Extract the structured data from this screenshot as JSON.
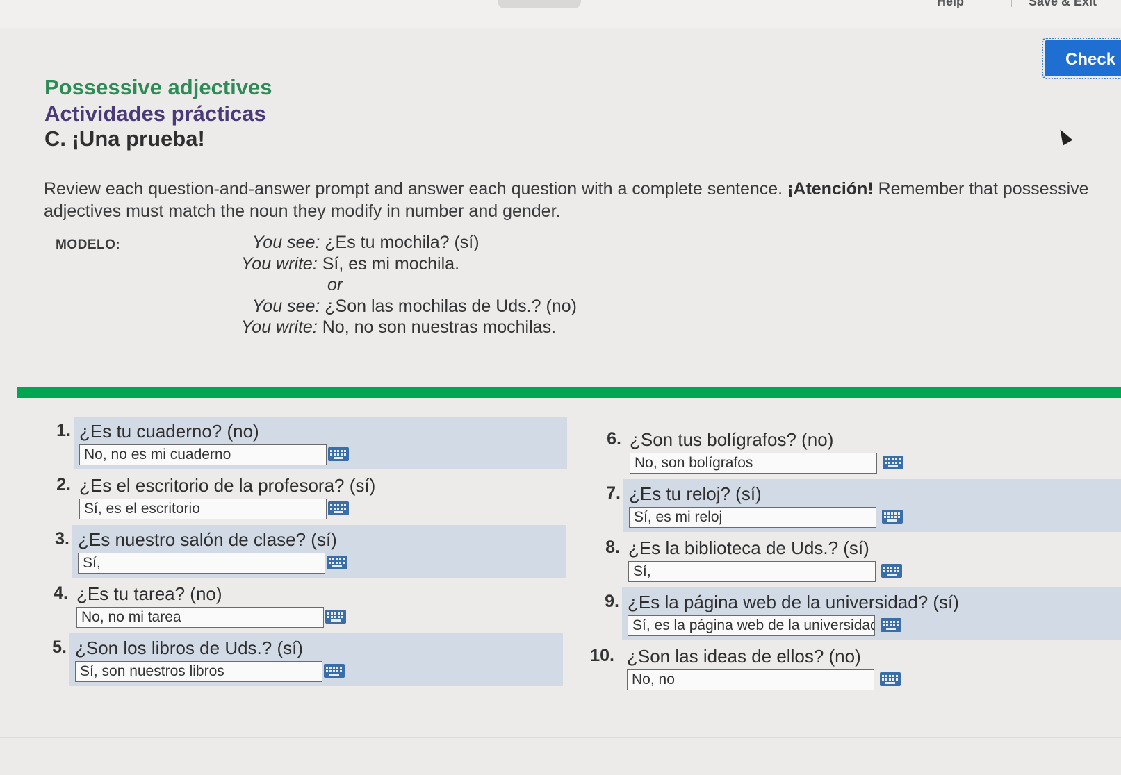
{
  "topbar": {
    "help": "Help",
    "save_exit": "Save & Exit"
  },
  "check_button": "Check",
  "header": {
    "topic": "Possessive adjectives",
    "subtitle": "Actividades prácticas",
    "section": "C. ¡Una prueba!"
  },
  "instructions": {
    "before": "Review each question-and-answer prompt and answer each question with a complete sentence. ",
    "bold": "¡Atención!",
    "after": " Remember that possessive adjectives must match the noun they modify in number and gender."
  },
  "modelo": {
    "label": "MODELO:",
    "see_label": "You see:",
    "write_label": "You write:",
    "see1": "¿Es tu mochila? (sí)",
    "write1": "Sí, es mi mochila.",
    "or": "or",
    "see2": "¿Son las mochilas de Uds.? (no)",
    "write2": "No, no son nuestras mochilas."
  },
  "questions": [
    {
      "num": "1.",
      "text": "¿Es tu cuaderno? (no)",
      "answer": "No, no es mi cuaderno"
    },
    {
      "num": "2.",
      "text": "¿Es el escritorio de la profesora? (sí)",
      "answer": "Sí, es el escritorio"
    },
    {
      "num": "3.",
      "text": "¿Es nuestro salón de clase? (sí)",
      "answer": "Sí,"
    },
    {
      "num": "4.",
      "text": "¿Es tu tarea? (no)",
      "answer": "No, no mi tarea"
    },
    {
      "num": "5.",
      "text": "¿Son los libros de Uds.? (sí)",
      "answer": "Sí, son nuestros libros"
    },
    {
      "num": "6.",
      "text": "¿Son tus bolígrafos? (no)",
      "answer": "No,  son bolígrafos"
    },
    {
      "num": "7.",
      "text": "¿Es tu reloj? (sí)",
      "answer": "Sí, es mi reloj"
    },
    {
      "num": "8.",
      "text": "¿Es la biblioteca de Uds.? (sí)",
      "answer": "Sí,"
    },
    {
      "num": "9.",
      "text": "¿Es la página web de la universidad? (sí)",
      "answer": "Sí, es la página web de la universidad"
    },
    {
      "num": "10.",
      "text": "¿Son las ideas de ellos? (no)",
      "answer": "No, no"
    }
  ],
  "colors": {
    "green_title": "#2e8b57",
    "purple_title": "#4b3a78",
    "green_bar": "#00a651",
    "row_shade": "#d2dae6",
    "button_blue": "#1f6ed1"
  },
  "icons": {
    "keyboard": "keyboard-icon"
  }
}
